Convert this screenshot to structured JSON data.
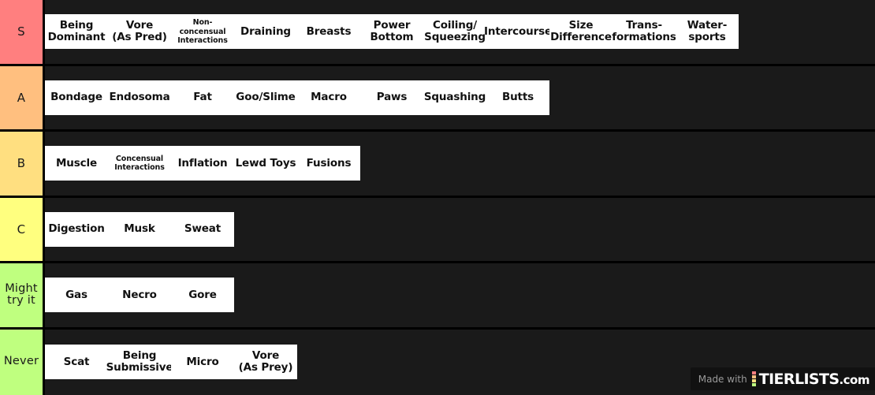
{
  "watermark": {
    "made_with": "Made with",
    "brand_name": "TIERLISTS",
    "brand_tld": ".com",
    "dot_colors": [
      "#ff7f7f",
      "#ffbf7f",
      "#ffdf80",
      "#bfff7f"
    ]
  },
  "tiers": [
    {
      "label": "S",
      "color": "#ff7f7f",
      "label_size": "normal",
      "items": [
        {
          "text": "Being\nDominant",
          "size": "normal"
        },
        {
          "text": "Vore\n(As Pred)",
          "size": "normal"
        },
        {
          "text": "Non-concensual\nInteractions",
          "size": "tiny"
        },
        {
          "text": "Draining",
          "size": "normal"
        },
        {
          "text": "Breasts",
          "size": "normal"
        },
        {
          "text": "Power\nBottom",
          "size": "normal"
        },
        {
          "text": "Coiling/\nSqueezing",
          "size": "normal"
        },
        {
          "text": "Intercourse",
          "size": "normal"
        },
        {
          "text": "Size\nDifference",
          "size": "normal"
        },
        {
          "text": "Trans-\nformations",
          "size": "normal"
        },
        {
          "text": "Water-\nsports",
          "size": "normal"
        }
      ]
    },
    {
      "label": "A",
      "color": "#ffbf7f",
      "label_size": "normal",
      "items": [
        {
          "text": "Bondage",
          "size": "normal"
        },
        {
          "text": "Endosoma",
          "size": "normal"
        },
        {
          "text": "Fat",
          "size": "normal"
        },
        {
          "text": "Goo/Slime",
          "size": "normal"
        },
        {
          "text": "Macro",
          "size": "normal"
        },
        {
          "text": "Paws",
          "size": "normal"
        },
        {
          "text": "Squashing",
          "size": "normal"
        },
        {
          "text": "Butts",
          "size": "normal"
        }
      ]
    },
    {
      "label": "B",
      "color": "#ffdf80",
      "label_size": "normal",
      "items": [
        {
          "text": "Muscle",
          "size": "normal"
        },
        {
          "text": "Concensual\nInteractions",
          "size": "tiny"
        },
        {
          "text": "Inflation",
          "size": "normal"
        },
        {
          "text": "Lewd Toys",
          "size": "normal"
        },
        {
          "text": "Fusions",
          "size": "normal"
        }
      ]
    },
    {
      "label": "C",
      "color": "#ffff7f",
      "label_size": "normal",
      "items": [
        {
          "text": "Digestion",
          "size": "normal"
        },
        {
          "text": "Musk",
          "size": "normal"
        },
        {
          "text": "Sweat",
          "size": "normal"
        }
      ]
    },
    {
      "label": "Might\ntry it",
      "color": "#bfff7f",
      "label_size": "small",
      "items": [
        {
          "text": "Gas",
          "size": "normal"
        },
        {
          "text": "Necro",
          "size": "normal"
        },
        {
          "text": "Gore",
          "size": "normal"
        }
      ]
    },
    {
      "label": "Never",
      "color": "#bfff7f",
      "label_size": "small",
      "items": [
        {
          "text": "Scat",
          "size": "normal"
        },
        {
          "text": "Being\nSubmissive",
          "size": "normal"
        },
        {
          "text": "Micro",
          "size": "normal"
        },
        {
          "text": "Vore\n(As Prey)",
          "size": "normal"
        }
      ]
    }
  ]
}
